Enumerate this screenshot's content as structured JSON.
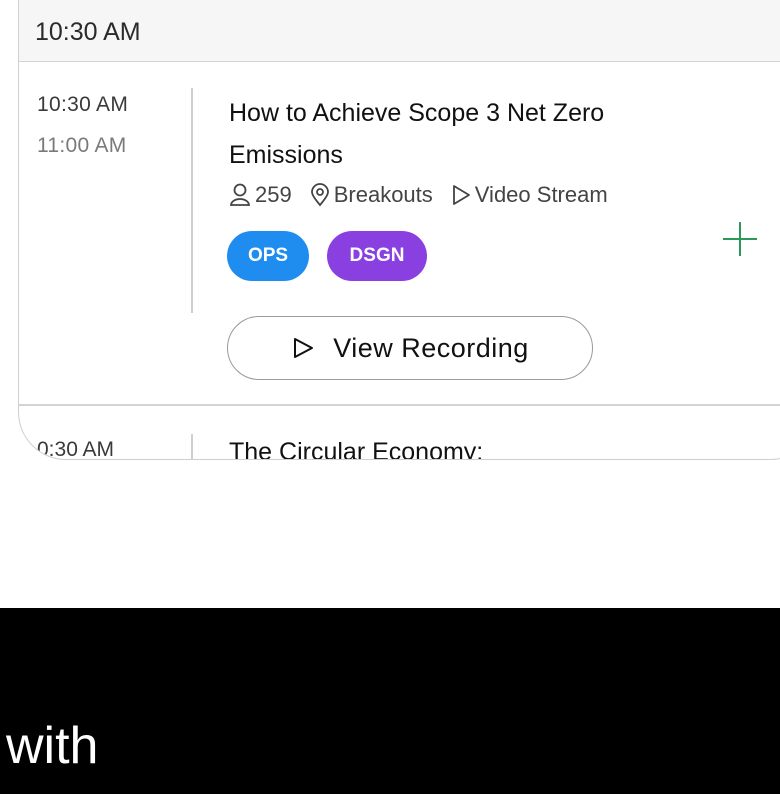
{
  "schedule": {
    "time_header": "10:30 AM",
    "session": {
      "start_time": "10:30 AM",
      "end_time": "11:00 AM",
      "title": "How to Achieve Scope 3 Net Zero Emissions",
      "attendees": "259",
      "location": "Breakouts",
      "stream": "Video Stream",
      "tags": [
        {
          "label": "OPS",
          "color": "#1f8cf0"
        },
        {
          "label": "DSGN",
          "color": "#8a3fe0"
        }
      ],
      "add_icon": "plus-icon",
      "view_recording_label": "View Recording"
    },
    "next_session": {
      "start_time": "0:30 AM",
      "title": "The Circular Economy:"
    }
  },
  "caption": {
    "text": "with"
  },
  "colors": {
    "accent_green": "#2a9a5a",
    "tag_ops": "#1f8cf0",
    "tag_dsgn": "#8a3fe0"
  }
}
